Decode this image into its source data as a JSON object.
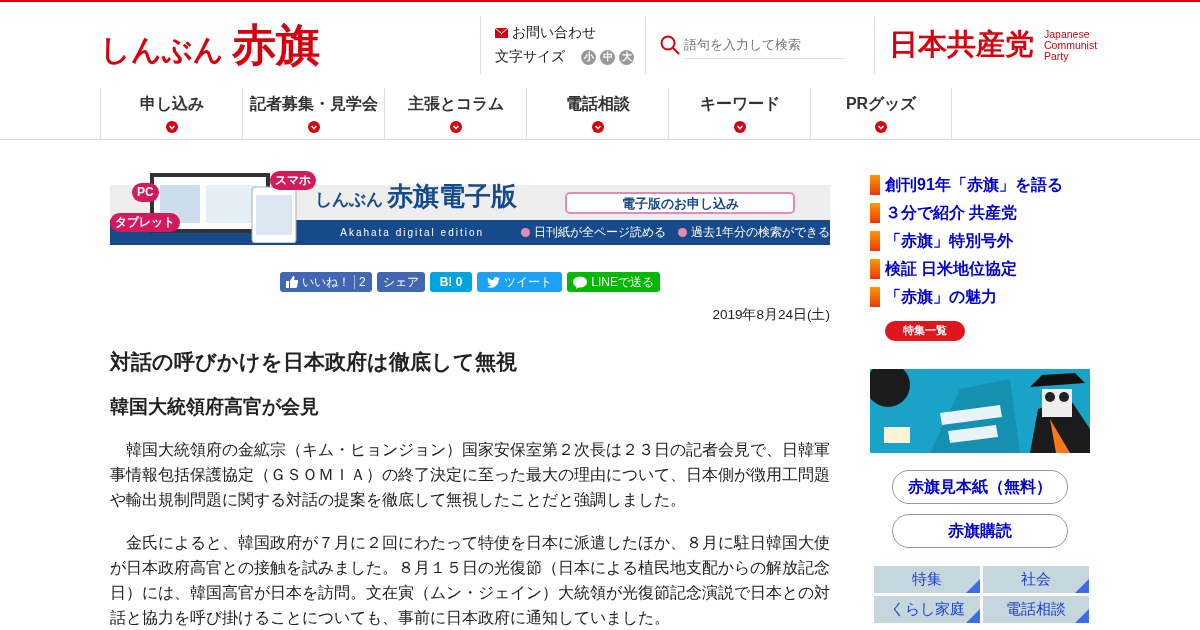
{
  "header": {
    "logo": {
      "kana": "しんぶん",
      "kanji": "赤旗"
    },
    "contact": "お問い合わせ",
    "font_size_label": "文字サイズ",
    "font_sizes": [
      "小",
      "中",
      "大"
    ],
    "search": {
      "placeholder": "語句を入力して検索"
    },
    "party": {
      "name": "日本共産党",
      "subtitle": [
        "Japanese",
        "Communist",
        "Party"
      ]
    }
  },
  "nav": [
    "申し込み",
    "記者募集・見学会",
    "主張とコラム",
    "電話相談",
    "キーワード",
    "PRグッズ"
  ],
  "banner": {
    "device_labels": [
      "PC",
      "タブレット",
      "スマホ"
    ],
    "kana": "しんぶん",
    "title": "赤旗電子版",
    "button": "電子版のお申し込み",
    "edition": "Akahata digital edition",
    "features": [
      "日刊紙が全ページ読める",
      "過去1年分の検索ができる"
    ]
  },
  "share": [
    {
      "kind": "like",
      "label": "いいね！",
      "count": "2"
    },
    {
      "kind": "share",
      "label": "シェア"
    },
    {
      "kind": "hatena",
      "label": "B!",
      "count": "0"
    },
    {
      "kind": "tweet",
      "label": "ツイート"
    },
    {
      "kind": "line",
      "label": "LINEで送る"
    }
  ],
  "article": {
    "date": "2019年8月24日(土)",
    "headline": "対話の呼びかけを日本政府は徹底して無視",
    "subheadline": "韓国大統領府高官が会見",
    "paragraphs": [
      "韓国大統領府の金絋宗（キム・ヒョンジョン）国家安保室第２次長は２３日の記者会見で、日韓軍事情報包括保護協定（ＧＳＯＭＩＡ）の終了決定に至った最大の理由について、日本側が徴用工問題や輸出規制問題に関する対話の提案を徹底して無視したことだと強調しました。",
      "金氏によると、韓国政府が７月に２回にわたって特使を日本に派遣したほか、８月に駐日韓国大使が日本政府高官との接触を試みました。８月１５日の光復節（日本による植民地支配からの解放記念日）には、韓国高官が日本を訪問。文在寅（ムン・ジェイン）大統領が光復節記念演説で日本との対話と協力を呼び掛けることについても、事前に日本政府に通知していました。"
    ]
  },
  "sidebar": {
    "features": [
      "創刊91年「赤旗」を語る",
      "３分で紹介 共産党",
      "「赤旗」特別号外",
      "検証 日米地位協定",
      "「赤旗」の魅力"
    ],
    "features_button": "特集一覧",
    "promo": {
      "kind": "picture"
    },
    "buttons": [
      "赤旗見本紙（無料）",
      "赤旗購読"
    ],
    "categories": [
      "特集",
      "社会",
      "くらし家庭",
      "電話相談"
    ]
  }
}
